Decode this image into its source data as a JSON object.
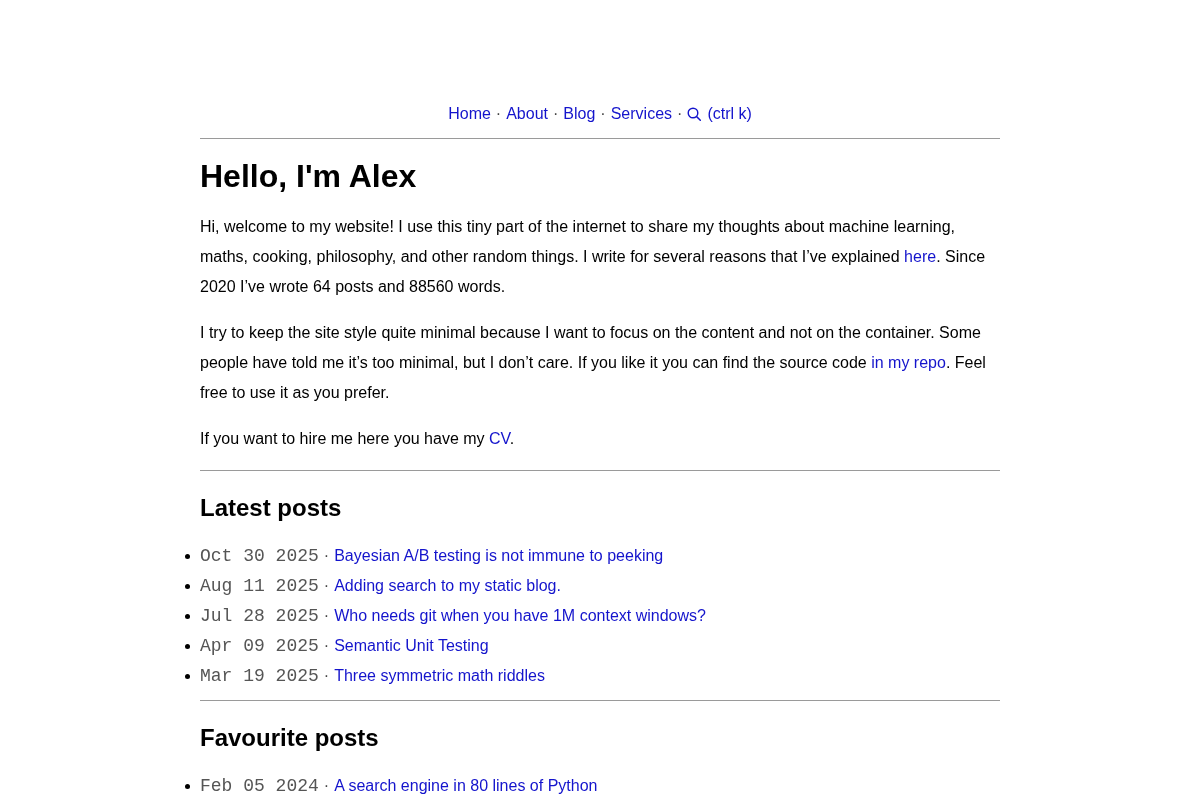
{
  "nav": {
    "separator": "·",
    "items": [
      {
        "kind": "link",
        "label": "Home"
      },
      {
        "kind": "link",
        "label": "About"
      },
      {
        "kind": "link",
        "label": "Blog"
      },
      {
        "kind": "link",
        "label": "Services"
      },
      {
        "kind": "search",
        "label": "(ctrl k)"
      }
    ]
  },
  "intro": {
    "title": "Hello, I'm Alex",
    "paragraphs": [
      [
        {
          "kind": "text",
          "text": "Hi, welcome to my website! I use this tiny part of the internet to share my thoughts about machine learning, maths, cooking, philosophy, and other random things. I write for several reasons that I’ve explained "
        },
        {
          "kind": "link",
          "text": "here"
        },
        {
          "kind": "text",
          "text": ". Since 2020 I’ve wrote 64 posts and 88560 words."
        }
      ],
      [
        {
          "kind": "text",
          "text": "I try to keep the site style quite minimal because I want to focus on the content and not on the container. Some people have told me it’s too minimal, but I don’t care. If you like it you can find the source code "
        },
        {
          "kind": "link",
          "text": "in my repo"
        },
        {
          "kind": "text",
          "text": ". Feel free to use it as you prefer."
        }
      ],
      [
        {
          "kind": "text",
          "text": "If you want to hire me here you have my "
        },
        {
          "kind": "link",
          "text": "CV"
        },
        {
          "kind": "text",
          "text": "."
        }
      ]
    ]
  },
  "sections": [
    {
      "title": "Latest posts",
      "separator": "·",
      "posts": [
        {
          "date": "Oct 30 2025",
          "title": "Bayesian A/B testing is not immune to peeking"
        },
        {
          "date": "Aug 11 2025",
          "title": "Adding search to my static blog."
        },
        {
          "date": "Jul 28 2025",
          "title": "Who needs git when you have 1M context windows?"
        },
        {
          "date": "Apr 09 2025",
          "title": "Semantic Unit Testing"
        },
        {
          "date": "Mar 19 2025",
          "title": "Three symmetric math riddles"
        }
      ]
    },
    {
      "title": "Favourite posts",
      "separator": "·",
      "posts": [
        {
          "date": "Feb 05 2024",
          "title": "A search engine in 80 lines of Python"
        }
      ]
    }
  ]
}
